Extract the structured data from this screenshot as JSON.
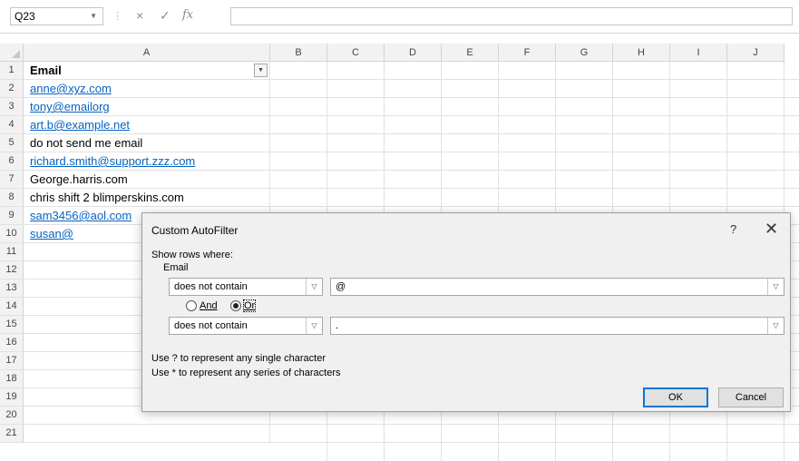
{
  "formula_bar": {
    "name_box": "Q23",
    "cancel_symbol": "×",
    "enter_symbol": "✓",
    "function_symbol": "fx",
    "formula": ""
  },
  "columns": [
    "A",
    "B",
    "C",
    "D",
    "E",
    "F",
    "G",
    "H",
    "I",
    "J"
  ],
  "rows": [
    {
      "num": "1",
      "a": "Email",
      "kind": "header"
    },
    {
      "num": "2",
      "a": "anne@xyz.com",
      "kind": "link"
    },
    {
      "num": "3",
      "a": "tony@emailorg",
      "kind": "link"
    },
    {
      "num": "4",
      "a": "art.b@example.net",
      "kind": "link"
    },
    {
      "num": "5",
      "a": "do not send me email",
      "kind": "text"
    },
    {
      "num": "6",
      "a": "richard.smith@support.zzz.com",
      "kind": "link"
    },
    {
      "num": "7",
      "a": "George.harris.com",
      "kind": "text"
    },
    {
      "num": "8",
      "a": "chris shift 2 blimperskins.com",
      "kind": "text"
    },
    {
      "num": "9",
      "a": "sam3456@aol.com",
      "kind": "link"
    },
    {
      "num": "10",
      "a": "susan@",
      "kind": "link"
    },
    {
      "num": "11",
      "a": "",
      "kind": "text"
    },
    {
      "num": "12",
      "a": "",
      "kind": "text"
    },
    {
      "num": "13",
      "a": "",
      "kind": "text"
    },
    {
      "num": "14",
      "a": "",
      "kind": "text"
    },
    {
      "num": "15",
      "a": "",
      "kind": "text"
    },
    {
      "num": "16",
      "a": "",
      "kind": "text"
    },
    {
      "num": "17",
      "a": "",
      "kind": "text"
    },
    {
      "num": "18",
      "a": "",
      "kind": "text"
    },
    {
      "num": "19",
      "a": "",
      "kind": "text"
    },
    {
      "num": "20",
      "a": "",
      "kind": "text"
    },
    {
      "num": "21",
      "a": "",
      "kind": "text"
    }
  ],
  "dialog": {
    "title": "Custom AutoFilter",
    "help": "?",
    "close": "✕",
    "show_rows_where": "Show rows where:",
    "field_name": "Email",
    "condition1": {
      "operator": "does not contain",
      "value": "@"
    },
    "logic": {
      "and_label": "And",
      "or_label": "Or",
      "selected": "Or"
    },
    "condition2": {
      "operator": "does not contain",
      "value": "."
    },
    "hint1": "Use ? to represent any single character",
    "hint2": "Use * to represent any series of characters",
    "ok_label": "OK",
    "cancel_label": "Cancel"
  },
  "colors": {
    "link": "#0563c1",
    "header_bg": "#f2f2f2",
    "dialog_bg": "#f0f0f0",
    "accent": "#0078d7"
  }
}
